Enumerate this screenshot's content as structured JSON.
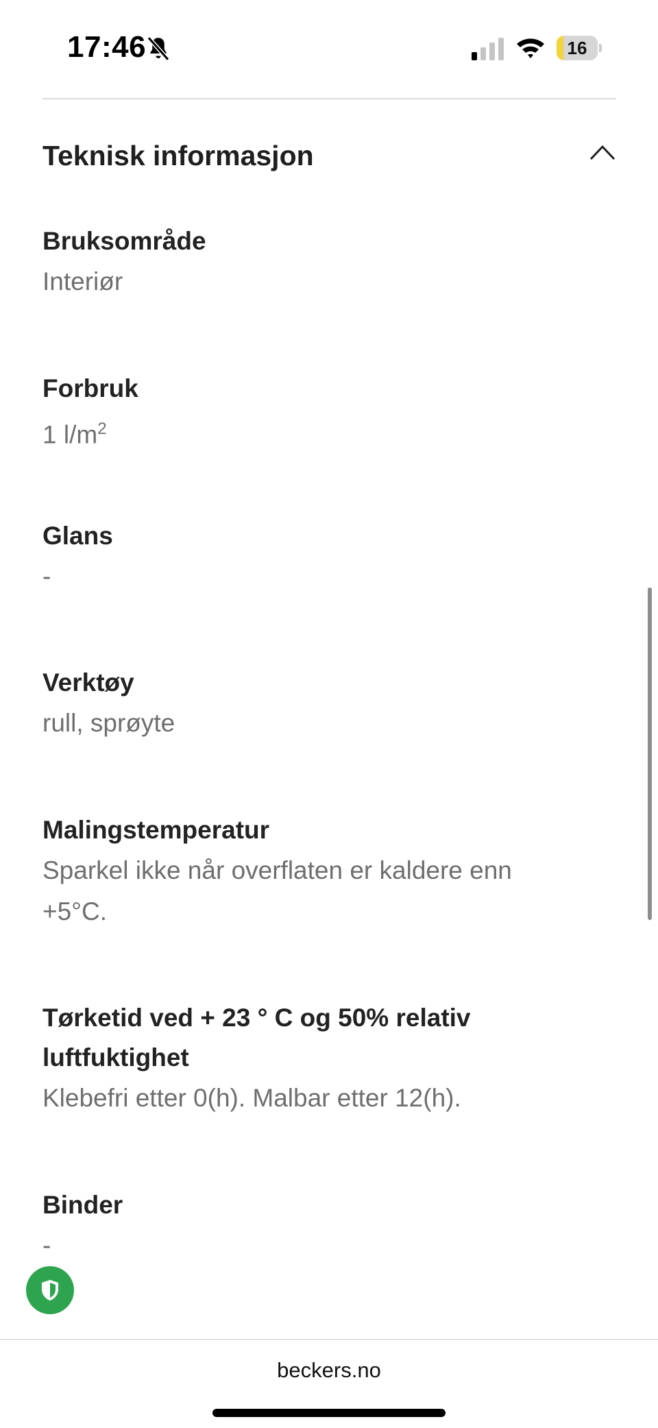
{
  "status_bar": {
    "time": "17:46",
    "battery_level": "16",
    "battery_fraction": 0.16,
    "icons": [
      "bell-slash-icon",
      "signal-icon",
      "wifi-icon",
      "battery-icon"
    ],
    "battery_accent": "#f5d33a"
  },
  "section": {
    "title": "Teknisk informasjon",
    "expanded": true,
    "toggle_icon": "chevron-up-icon"
  },
  "specs": [
    {
      "label": "Bruksområde",
      "value": "Interiør"
    },
    {
      "label": "Forbruk",
      "value": "1 l/m",
      "value_sup": "2"
    },
    {
      "label": "Glans",
      "value": "-"
    },
    {
      "label": "Verktøy",
      "value": "rull, sprøyte"
    },
    {
      "label": "Malingstemperatur",
      "value": "Sparkel ikke når overflaten er kaldere enn +5°C."
    },
    {
      "label": "Tørketid ved + 23 ° C og 50% relativ luftfuktighet",
      "value": "Klebefri etter 0(h). Malbar etter 12(h)."
    },
    {
      "label": "Binder",
      "value": "-"
    }
  ],
  "privacy_button": {
    "icon": "shield-icon",
    "color": "#2ea44f"
  },
  "browser": {
    "url": "beckers.no"
  }
}
